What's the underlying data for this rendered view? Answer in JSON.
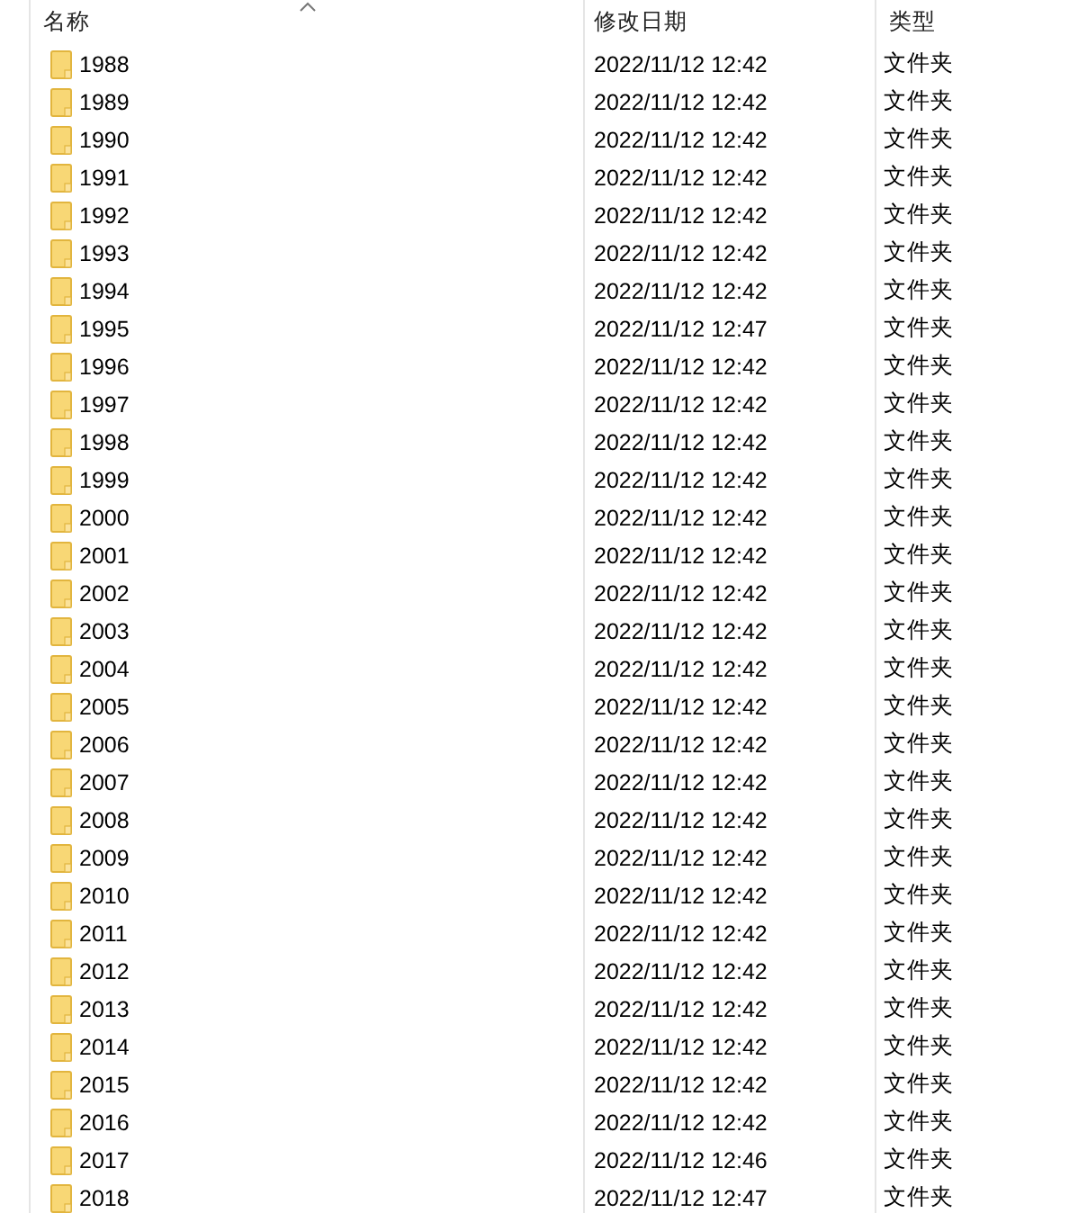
{
  "columns": [
    "名称",
    "修改日期",
    "类型"
  ],
  "rows": [
    {
      "name": "1988",
      "modified": "2022/11/12 12:42",
      "type": "文件夹"
    },
    {
      "name": "1989",
      "modified": "2022/11/12 12:42",
      "type": "文件夹"
    },
    {
      "name": "1990",
      "modified": "2022/11/12 12:42",
      "type": "文件夹"
    },
    {
      "name": "1991",
      "modified": "2022/11/12 12:42",
      "type": "文件夹"
    },
    {
      "name": "1992",
      "modified": "2022/11/12 12:42",
      "type": "文件夹"
    },
    {
      "name": "1993",
      "modified": "2022/11/12 12:42",
      "type": "文件夹"
    },
    {
      "name": "1994",
      "modified": "2022/11/12 12:42",
      "type": "文件夹"
    },
    {
      "name": "1995",
      "modified": "2022/11/12 12:47",
      "type": "文件夹"
    },
    {
      "name": "1996",
      "modified": "2022/11/12 12:42",
      "type": "文件夹"
    },
    {
      "name": "1997",
      "modified": "2022/11/12 12:42",
      "type": "文件夹"
    },
    {
      "name": "1998",
      "modified": "2022/11/12 12:42",
      "type": "文件夹"
    },
    {
      "name": "1999",
      "modified": "2022/11/12 12:42",
      "type": "文件夹"
    },
    {
      "name": "2000",
      "modified": "2022/11/12 12:42",
      "type": "文件夹"
    },
    {
      "name": "2001",
      "modified": "2022/11/12 12:42",
      "type": "文件夹"
    },
    {
      "name": "2002",
      "modified": "2022/11/12 12:42",
      "type": "文件夹"
    },
    {
      "name": "2003",
      "modified": "2022/11/12 12:42",
      "type": "文件夹"
    },
    {
      "name": "2004",
      "modified": "2022/11/12 12:42",
      "type": "文件夹"
    },
    {
      "name": "2005",
      "modified": "2022/11/12 12:42",
      "type": "文件夹"
    },
    {
      "name": "2006",
      "modified": "2022/11/12 12:42",
      "type": "文件夹"
    },
    {
      "name": "2007",
      "modified": "2022/11/12 12:42",
      "type": "文件夹"
    },
    {
      "name": "2008",
      "modified": "2022/11/12 12:42",
      "type": "文件夹"
    },
    {
      "name": "2009",
      "modified": "2022/11/12 12:42",
      "type": "文件夹"
    },
    {
      "name": "2010",
      "modified": "2022/11/12 12:42",
      "type": "文件夹"
    },
    {
      "name": "2011",
      "modified": "2022/11/12 12:42",
      "type": "文件夹"
    },
    {
      "name": "2012",
      "modified": "2022/11/12 12:42",
      "type": "文件夹"
    },
    {
      "name": "2013",
      "modified": "2022/11/12 12:42",
      "type": "文件夹"
    },
    {
      "name": "2014",
      "modified": "2022/11/12 12:42",
      "type": "文件夹"
    },
    {
      "name": "2015",
      "modified": "2022/11/12 12:42",
      "type": "文件夹"
    },
    {
      "name": "2016",
      "modified": "2022/11/12 12:42",
      "type": "文件夹"
    },
    {
      "name": "2017",
      "modified": "2022/11/12 12:46",
      "type": "文件夹"
    },
    {
      "name": "2018",
      "modified": "2022/11/12 12:47",
      "type": "文件夹"
    }
  ]
}
